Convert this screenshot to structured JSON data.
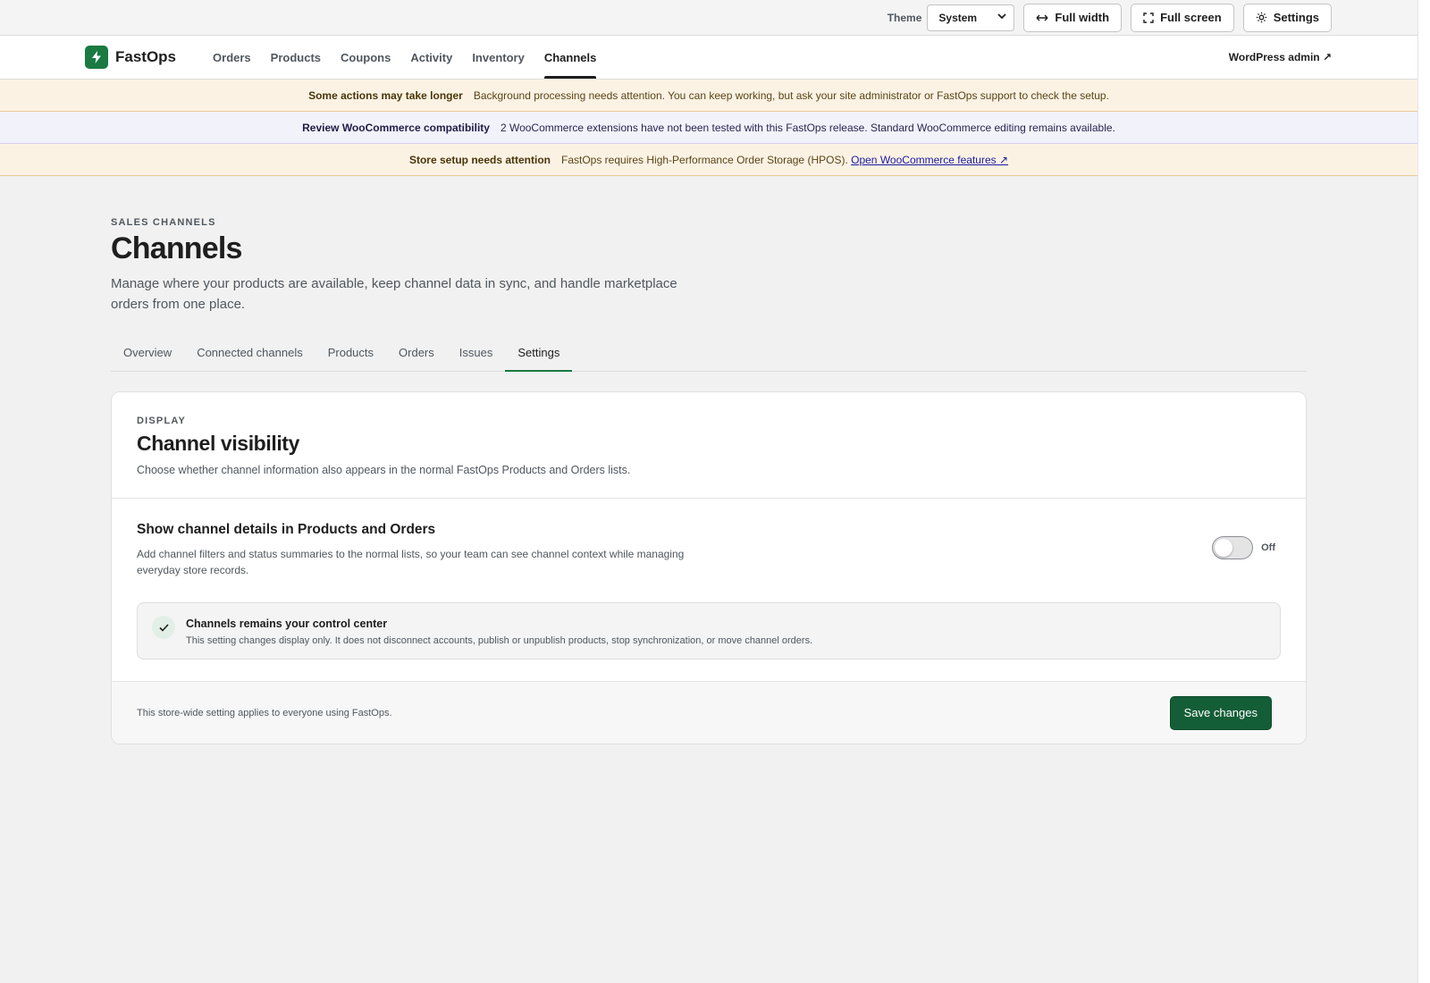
{
  "utility": {
    "theme_label": "Theme",
    "theme_value": "System",
    "full_width_label": "Full width",
    "full_screen_label": "Full screen",
    "settings_label": "Settings"
  },
  "nav": {
    "brand": "FastOps",
    "links": [
      "Orders",
      "Products",
      "Coupons",
      "Activity",
      "Inventory",
      "Channels"
    ],
    "active": "Channels",
    "wp_admin": "WordPress admin ↗"
  },
  "notices": [
    {
      "title": "Some actions may take longer",
      "text": "Background processing needs attention. You can keep working, but ask your site administrator or FastOps support to check the setup."
    },
    {
      "title": "Review WooCommerce compatibility",
      "text": "2 WooCommerce extensions have not been tested with this FastOps release. Standard WooCommerce editing remains available."
    },
    {
      "title": "Store setup needs attention",
      "text": "FastOps requires High-Performance Order Storage (HPOS).",
      "link": "Open WooCommerce features ↗"
    }
  ],
  "header": {
    "eyebrow": "SALES CHANNELS",
    "title": "Channels",
    "description": "Manage where your products are available, keep channel data in sync, and handle marketplace orders from one place."
  },
  "tabs": [
    "Overview",
    "Connected channels",
    "Products",
    "Orders",
    "Issues",
    "Settings"
  ],
  "active_tab": "Settings",
  "card": {
    "eyebrow": "DISPLAY",
    "title": "Channel visibility",
    "description": "Choose whether channel information also appears in the normal FastOps Products and Orders lists.",
    "setting_title": "Show channel details in Products and Orders",
    "setting_desc": "Add channel filters and status summaries to the normal lists, so your team can see channel context while managing everyday store records.",
    "toggle_state": "Off",
    "info_title": "Channels remains your control center",
    "info_desc": "This setting changes display only. It does not disconnect accounts, publish or unpublish products, stop synchronization, or move channel orders.",
    "foot_note": "This store-wide setting applies to everyone using FastOps.",
    "save_label": "Save changes"
  },
  "colors": {
    "brand": "#1a7a42",
    "save_button": "#135e37",
    "warn_bg": "#fcf2e4",
    "info_bg": "#f2f2fb"
  },
  "icons": {
    "brand": "bolt-icon",
    "full_width": "arrows-horizontal-icon",
    "full_screen": "expand-icon",
    "settings": "gear-icon",
    "select": "chevron-down-icon",
    "check": "check-icon"
  }
}
